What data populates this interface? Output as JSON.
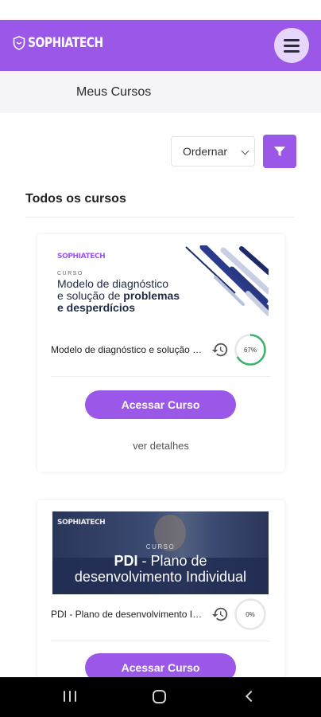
{
  "header": {
    "brand": "SOPHIATECH",
    "menu_icon": "hamburger-menu-icon",
    "accent": "#9a57e8"
  },
  "subheader": {
    "title": "Meus Cursos"
  },
  "toolbar": {
    "sort_label": "Ordernar",
    "filter_icon": "filter-funnel-icon"
  },
  "section": {
    "title": "Todos os cursos"
  },
  "courses": [
    {
      "thumb_brand": "SOPHIATECH",
      "thumb_kicker": "CURSO",
      "thumb_title_1": "Modelo de diagnóstico",
      "thumb_title_2": "e solução de",
      "thumb_title_3": "problemas",
      "thumb_title_4": "e desperdícios",
      "name": "Modelo de diagnóstico e solução de problemas e desperdícios",
      "progress_label": "67%",
      "progress": 0.67,
      "button_label": "Acessar Curso",
      "details_label": "ver detalhes"
    },
    {
      "thumb_brand": "SOPHIATECH",
      "thumb_kicker": "CURSO",
      "thumb_title_1": "PDI",
      "thumb_title_2": " - Plano de",
      "thumb_title_3": "desenvolvimento Individual",
      "name": "PDI - Plano de desenvolvimento Individual",
      "progress_label": "0%",
      "progress": 0,
      "button_label": "Acessar Curso"
    }
  ],
  "colors": {
    "progress_green": "#3db06b",
    "ring_track": "#e6e6e6",
    "nav_bg": "#000000"
  }
}
